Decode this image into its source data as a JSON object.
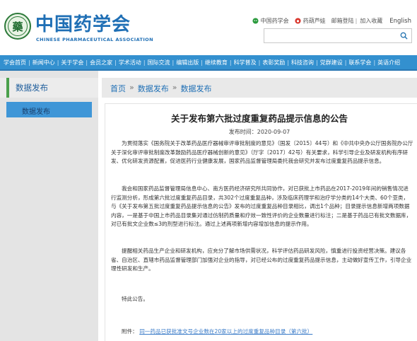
{
  "header": {
    "logo_glyph": "藥",
    "logo_cn": "中国药学会",
    "logo_en": "CHINESE PHARMACEUTICAL ASSOCIATION",
    "toplinks": {
      "cpa": "中国药学会",
      "voice": "药葫芦娃",
      "email_login": "邮箱登陆",
      "sep": "|",
      "favorite": "加入收藏",
      "english": "English"
    },
    "search": {
      "value": "",
      "placeholder": ""
    },
    "colors": {
      "brand_blue": "#1f6fb5",
      "brand_green": "#2d7a3a"
    }
  },
  "nav": {
    "items": [
      "学会首页",
      "新闻中心",
      "关于学会",
      "会员之家",
      "学术活动",
      "国际交流",
      "编辑出版",
      "继续教育",
      "科学普及",
      "表彰奖励",
      "科技咨询",
      "党群建设",
      "联系学会",
      "英语介绍"
    ],
    "separator": "|",
    "bg_color": "#3390cf"
  },
  "sidebar": {
    "title": "数据发布",
    "items": [
      {
        "label": "数据发布"
      }
    ]
  },
  "breadcrumb": {
    "items": [
      "首页",
      "数据发布",
      "数据发布"
    ],
    "arrow": "»"
  },
  "article": {
    "title": "关于发布第六批过度重复药品提示信息的公告",
    "date_label": "发布时间：",
    "date": "2020-09-07",
    "paragraphs": [
      "为贯彻落实《国务院关于改革药品医疗器械审评审批制度的意见》（国发〔2015〕44号）和《中共中央办公厅国务院办公厅关于深化审评审批制度改革鼓励药品医疗器械创新的意见》（厅字〔2017〕42号）有关要求，科学引导企业及研发机构有序研发、优化研发资源配置，促进医药行业健康发展，国家药品监督管理局委托我会研究并发布过度重复药品提示信息。",
      "我会和国家药品监督管理局信息中心、南方医药经济研究所共同协作，对已获批上市药品在2017-2019年间的销售情况进行监测分析，形成第六批过度重复药品目录，共302个过度重复品种，涉及临床药理学和治疗学分类的14个大类、60个亚类，与《关于发布第五批过度重复药品提示信息的公告》发布的过度重复品种目录相比，调出1个品种；目录提示信息新增两项数据内容，一是基于中国上市药品目录集对通过仿制药质量和疗效一致性评价的企业数量进行标注；二是基于药品已有批文数据库，对已有批文企业数≤3的剂型进行标注。通过上述两项新增内容增加信息的提示作用。",
      "提醒相关药品生产企业和研发机构，应充分了解市场供需状况，科学评估药品研发风险，慎重进行投资经营决策。建议各省、自治区、直辖市药品监督管理部门加强对企业的指导，对已经公布的过度重复药品提示信息，主动做好宣传工作，引导企业理性研发和生产。",
      "特此公告。"
    ],
    "attachment_label": "附件：",
    "attachment_link": "同一药品已获批准文号企业数在20家以上的过度重复品种目录（第六批）"
  }
}
